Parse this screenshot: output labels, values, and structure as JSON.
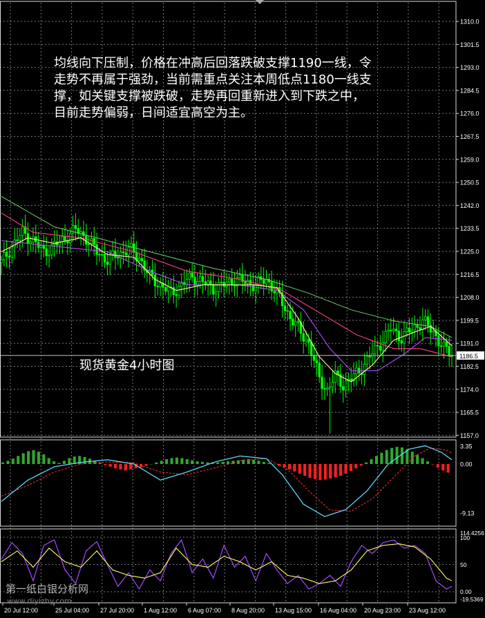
{
  "annotation": {
    "lines": [
      "均线向下压制，价格在冲高后回落跌破支撑1190一线，令",
      "走势不再属于强劲，当前需重点关注本周低点1180一线支",
      "撑，如关键支撑被跌破，走势再回重新进入到下跌之中，",
      "目前走势偏弱，日间适宜高空为主。"
    ]
  },
  "caption": "现货黄金4小时图",
  "watermark": {
    "text": "第一纸白银分析网",
    "url": "www.diyizhy.com"
  },
  "colors": {
    "background": "#000000",
    "grid": "#7a7a7a",
    "bull_candle": "#00ff00",
    "bear_candle": "#00ff00",
    "ma_fast": "#ffff99",
    "ma_mid": "#b44cff",
    "ma_slow": "#ff4080",
    "ma_long": "#6fd16f",
    "macd_pos": "#2fa82f",
    "macd_neg": "#ff2020",
    "macd_main": "#5fd7ff",
    "macd_signal": "#ff3030",
    "stoch_k": "#a34cff",
    "stoch_d": "#ffff66",
    "price_line": "#c0c0c0"
  },
  "chart_data": [
    {
      "type": "candlestick",
      "current_price_label": "1186.5",
      "current_price": 1186.5,
      "ylim": [
        1157.0,
        1314.0
      ],
      "y_ticks": [
        "1310.0",
        "1301.5",
        "1293.0",
        "1284.5",
        "1276.0",
        "1267.5",
        "1259.0",
        "1250.5",
        "1242.0",
        "1233.5",
        "1225.0",
        "1216.5",
        "1208.0",
        "1199.5",
        "1191.0",
        "1182.5",
        "1174.0",
        "1165.5",
        "1157.0"
      ],
      "x_ticks": [
        "20 Jul 12:00",
        "25 Jul 04:00",
        "27 Jul 20:00",
        "1 Aug 12:00",
        "6 Aug 07:00",
        "8 Aug 20:00",
        "13 Aug 15:00",
        "16 Aug 04:00",
        "20 Aug 23:00",
        "23 Aug 12:00"
      ],
      "close_path": [
        [
          0,
          1220
        ],
        [
          4,
          1226
        ],
        [
          8,
          1231
        ],
        [
          12,
          1228
        ],
        [
          16,
          1224
        ],
        [
          20,
          1226
        ],
        [
          24,
          1229
        ],
        [
          28,
          1232
        ],
        [
          32,
          1229
        ],
        [
          36,
          1224
        ],
        [
          40,
          1221
        ],
        [
          44,
          1223
        ],
        [
          48,
          1225
        ],
        [
          52,
          1222
        ],
        [
          56,
          1215
        ],
        [
          60,
          1212
        ],
        [
          64,
          1209
        ],
        [
          68,
          1212
        ],
        [
          72,
          1215
        ],
        [
          76,
          1213
        ],
        [
          80,
          1211
        ],
        [
          84,
          1212
        ],
        [
          88,
          1214
        ],
        [
          92,
          1213
        ],
        [
          96,
          1212
        ],
        [
          100,
          1214
        ],
        [
          104,
          1209
        ],
        [
          108,
          1202
        ],
        [
          112,
          1196
        ],
        [
          116,
          1191
        ],
        [
          120,
          1178
        ],
        [
          123,
          1174
        ],
        [
          126,
          1179
        ],
        [
          129,
          1176
        ],
        [
          132,
          1178
        ],
        [
          135,
          1181
        ],
        [
          139,
          1186
        ],
        [
          143,
          1191
        ],
        [
          147,
          1196
        ],
        [
          151,
          1193
        ],
        [
          155,
          1196
        ],
        [
          159,
          1199
        ],
        [
          163,
          1195
        ],
        [
          167,
          1189
        ],
        [
          170,
          1187
        ]
      ],
      "ma_fast": [
        [
          0,
          1224
        ],
        [
          10,
          1229
        ],
        [
          20,
          1227
        ],
        [
          30,
          1229
        ],
        [
          40,
          1223
        ],
        [
          50,
          1222
        ],
        [
          58,
          1214
        ],
        [
          66,
          1210
        ],
        [
          76,
          1212
        ],
        [
          86,
          1212
        ],
        [
          96,
          1212
        ],
        [
          104,
          1211
        ],
        [
          112,
          1200
        ],
        [
          120,
          1186
        ],
        [
          126,
          1180
        ],
        [
          132,
          1177
        ],
        [
          140,
          1183
        ],
        [
          148,
          1192
        ],
        [
          156,
          1195
        ],
        [
          162,
          1197
        ],
        [
          170,
          1190
        ]
      ],
      "ma_mid": [
        [
          0,
          1228
        ],
        [
          20,
          1226
        ],
        [
          40,
          1224
        ],
        [
          56,
          1217
        ],
        [
          70,
          1212
        ],
        [
          90,
          1212
        ],
        [
          104,
          1210
        ],
        [
          114,
          1203
        ],
        [
          124,
          1189
        ],
        [
          132,
          1181
        ],
        [
          142,
          1181
        ],
        [
          152,
          1187
        ],
        [
          160,
          1193
        ],
        [
          170,
          1192
        ]
      ],
      "ma_slow": [
        [
          0,
          1238
        ],
        [
          12,
          1231
        ],
        [
          30,
          1229
        ],
        [
          50,
          1224
        ],
        [
          70,
          1217
        ],
        [
          90,
          1214
        ],
        [
          106,
          1210
        ],
        [
          120,
          1202
        ],
        [
          134,
          1194
        ],
        [
          148,
          1189
        ],
        [
          158,
          1189
        ],
        [
          170,
          1186
        ]
      ],
      "ma_long": [
        [
          0,
          1244
        ],
        [
          20,
          1233
        ],
        [
          40,
          1228
        ],
        [
          60,
          1223
        ],
        [
          80,
          1218
        ],
        [
          100,
          1214
        ],
        [
          116,
          1209
        ],
        [
          132,
          1203
        ],
        [
          148,
          1199
        ],
        [
          162,
          1197
        ],
        [
          170,
          1193
        ]
      ]
    },
    {
      "type": "macd",
      "y_ticks": [
        "3.35",
        "0.00",
        "-9.13"
      ],
      "ylim": [
        -10.5,
        4.2
      ],
      "histogram": [
        0.3,
        0.6,
        1.0,
        1.5,
        2.0,
        2.4,
        2.6,
        2.3,
        1.8,
        1.1,
        0.5,
        0.2,
        0.6,
        1.1,
        1.4,
        1.5,
        1.3,
        1.0,
        0.6,
        0.2,
        -0.2,
        -0.5,
        -0.8,
        -1.0,
        -1.2,
        -1.0,
        -0.8,
        -0.6,
        -0.3,
        0.0,
        0.3,
        0.6,
        0.9,
        1.1,
        1.2,
        1.1,
        0.9,
        0.7,
        0.5,
        0.4,
        0.3,
        0.2,
        0.3,
        0.4,
        0.5,
        0.6,
        0.7,
        0.8,
        0.9,
        0.8,
        0.6,
        0.4,
        0.2,
        0.0,
        -0.3,
        -0.6,
        -1.0,
        -1.4,
        -1.8,
        -2.2,
        -2.6,
        -2.8,
        -3.0,
        -2.9,
        -2.7,
        -2.5,
        -2.2,
        -1.8,
        -1.3,
        -0.8,
        -0.3,
        0.3,
        0.9,
        1.5,
        2.1,
        2.6,
        3.0,
        3.2,
        3.1,
        2.8,
        2.3,
        1.7,
        1.1,
        0.5,
        -0.1,
        -0.7,
        -1.2,
        -1.6
      ],
      "main": [
        [
          0,
          -7
        ],
        [
          10,
          -3
        ],
        [
          20,
          -0.5
        ],
        [
          30,
          0.3
        ],
        [
          40,
          0.8
        ],
        [
          50,
          0
        ],
        [
          60,
          -3
        ],
        [
          70,
          -1.5
        ],
        [
          80,
          0.3
        ],
        [
          90,
          1.5
        ],
        [
          100,
          1.0
        ],
        [
          106,
          -2
        ],
        [
          114,
          -7.5
        ],
        [
          122,
          -9.8
        ],
        [
          130,
          -8.5
        ],
        [
          138,
          -5
        ],
        [
          146,
          0
        ],
        [
          154,
          2.8
        ],
        [
          160,
          3.4
        ],
        [
          166,
          2.2
        ],
        [
          170,
          0.8
        ]
      ],
      "signal": [
        [
          0,
          -6
        ],
        [
          10,
          -4
        ],
        [
          20,
          -1.5
        ],
        [
          30,
          0
        ],
        [
          40,
          0.4
        ],
        [
          50,
          0.2
        ],
        [
          60,
          -1.5
        ],
        [
          70,
          -2
        ],
        [
          80,
          -0.8
        ],
        [
          90,
          0.6
        ],
        [
          100,
          1.0
        ],
        [
          108,
          -1
        ],
        [
          116,
          -5
        ],
        [
          124,
          -8.6
        ],
        [
          132,
          -8.8
        ],
        [
          140,
          -6.5
        ],
        [
          148,
          -2.5
        ],
        [
          156,
          1.5
        ],
        [
          162,
          3.0
        ],
        [
          168,
          2.6
        ],
        [
          170,
          2.0
        ]
      ]
    },
    {
      "type": "stochastic",
      "y_ticks": [
        "114.4256",
        "100",
        "50",
        "0.00",
        "-19.5369"
      ],
      "ylim": [
        -19.5369,
        114.4256
      ],
      "k": [
        [
          0,
          60
        ],
        [
          4,
          90
        ],
        [
          8,
          70
        ],
        [
          12,
          20
        ],
        [
          16,
          85
        ],
        [
          20,
          95
        ],
        [
          24,
          40
        ],
        [
          28,
          15
        ],
        [
          32,
          75
        ],
        [
          36,
          92
        ],
        [
          40,
          50
        ],
        [
          44,
          10
        ],
        [
          48,
          35
        ],
        [
          52,
          5
        ],
        [
          56,
          40
        ],
        [
          60,
          20
        ],
        [
          64,
          70
        ],
        [
          68,
          95
        ],
        [
          72,
          35
        ],
        [
          76,
          60
        ],
        [
          80,
          25
        ],
        [
          84,
          85
        ],
        [
          88,
          45
        ],
        [
          92,
          65
        ],
        [
          96,
          20
        ],
        [
          100,
          70
        ],
        [
          104,
          40
        ],
        [
          108,
          15
        ],
        [
          112,
          30
        ],
        [
          116,
          5
        ],
        [
          120,
          15
        ],
        [
          124,
          30
        ],
        [
          128,
          10
        ],
        [
          132,
          55
        ],
        [
          136,
          85
        ],
        [
          140,
          70
        ],
        [
          144,
          90
        ],
        [
          148,
          95
        ],
        [
          152,
          80
        ],
        [
          156,
          85
        ],
        [
          160,
          70
        ],
        [
          164,
          20
        ],
        [
          168,
          5
        ],
        [
          170,
          10
        ]
      ],
      "d": [
        [
          0,
          55
        ],
        [
          6,
          75
        ],
        [
          12,
          45
        ],
        [
          18,
          80
        ],
        [
          24,
          55
        ],
        [
          30,
          45
        ],
        [
          36,
          75
        ],
        [
          42,
          40
        ],
        [
          48,
          30
        ],
        [
          54,
          25
        ],
        [
          60,
          35
        ],
        [
          66,
          80
        ],
        [
          72,
          50
        ],
        [
          78,
          45
        ],
        [
          84,
          65
        ],
        [
          90,
          55
        ],
        [
          96,
          40
        ],
        [
          102,
          55
        ],
        [
          108,
          30
        ],
        [
          114,
          25
        ],
        [
          120,
          15
        ],
        [
          126,
          20
        ],
        [
          132,
          40
        ],
        [
          138,
          75
        ],
        [
          144,
          85
        ],
        [
          150,
          88
        ],
        [
          156,
          82
        ],
        [
          162,
          60
        ],
        [
          168,
          25
        ],
        [
          170,
          20
        ]
      ]
    }
  ]
}
